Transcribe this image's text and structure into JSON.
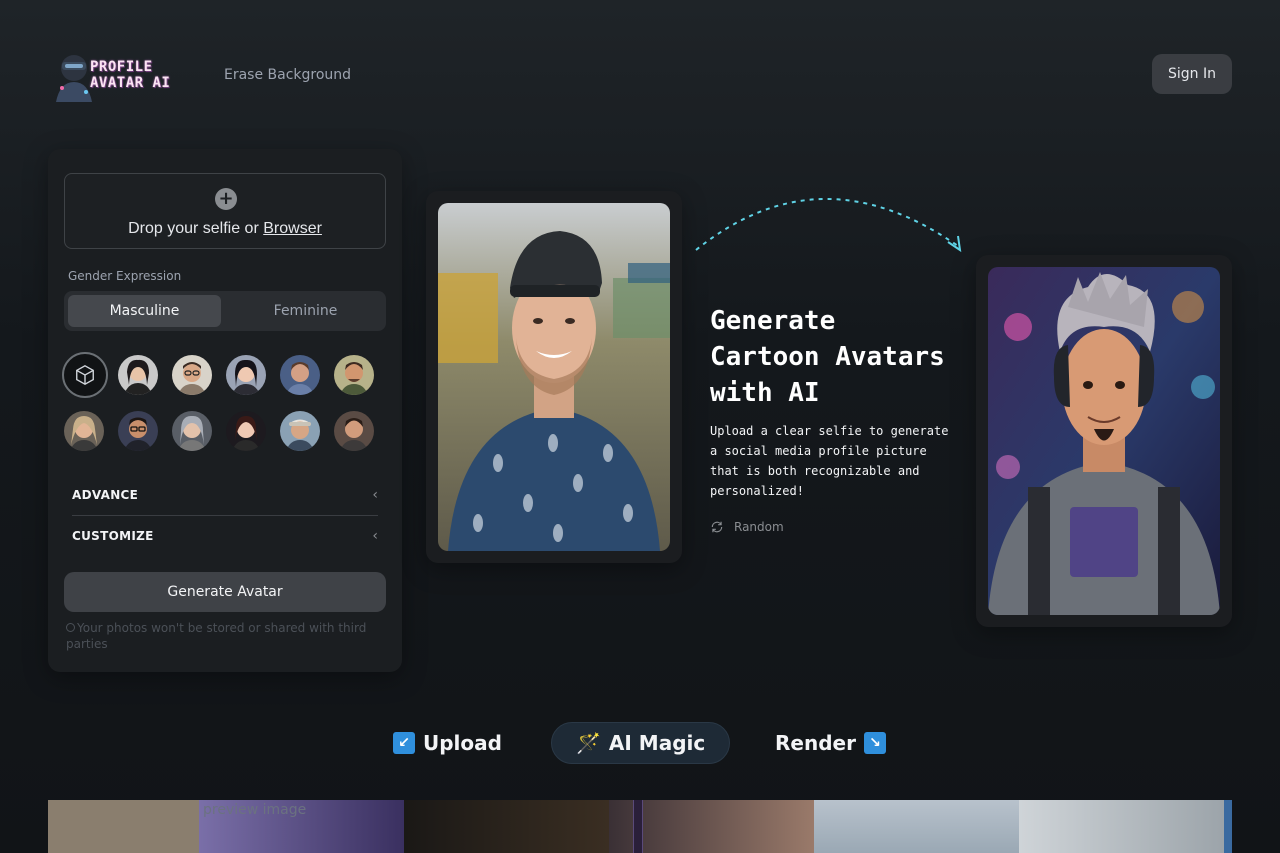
{
  "header": {
    "logo_line1": "PROFILE",
    "logo_line2": "AVATAR AI",
    "nav_erase": "Erase Background",
    "signin_label": "Sign In"
  },
  "panel": {
    "dropzone_text": "Drop your selfie or ",
    "dropzone_link": "Browser",
    "gender_label": "Gender Expression",
    "gender_options": [
      "Masculine",
      "Feminine"
    ],
    "gender_selected": "Masculine",
    "advance_label": "ADVANCE",
    "customize_label": "CUSTOMIZE",
    "generate_label": "Generate Avatar",
    "privacy_text": "Your photos won't be stored or shared with third parties"
  },
  "hero": {
    "title": "Generate Cartoon Avatars with AI",
    "description": "Upload a clear selfie to generate a social media profile picture that is both recognizable and personalized!",
    "random_label": "Random"
  },
  "steps": {
    "upload": "Upload",
    "ai_magic": "AI Magic",
    "render": "Render",
    "upload_icon": "↙",
    "render_icon": "↘",
    "magic_icon": "🪄"
  },
  "gallery": {
    "broken_image_alt": "preview image"
  },
  "colors": {
    "arrow": "#5fd3e6",
    "step_badge": "#2f8fdc"
  }
}
